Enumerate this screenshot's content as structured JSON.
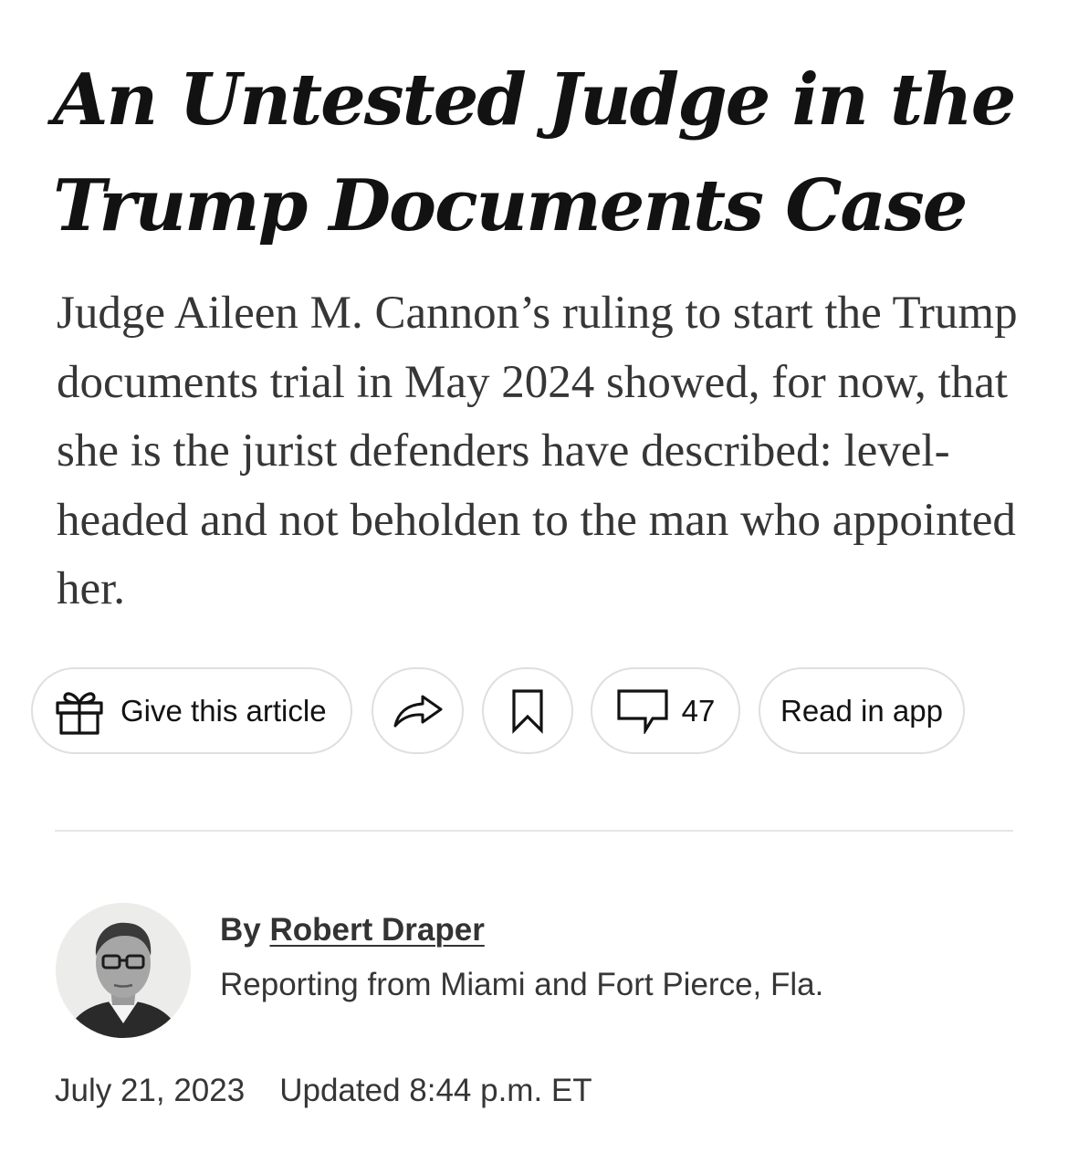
{
  "article": {
    "headline": "An Untested Judge in the Trump Documents Case",
    "summary": "Judge Aileen M. Cannon’s ruling to start the Trump documents trial in May 2024 showed, for now, that she is the jurist defenders have described: level-headed and not beholden to the man who appointed her."
  },
  "actions": {
    "gift": {
      "label": "Give this article",
      "icon": "gift-icon"
    },
    "share": {
      "icon": "share-arrow-icon"
    },
    "save": {
      "icon": "bookmark-icon"
    },
    "comments": {
      "count": "47",
      "icon": "comment-bubble-icon"
    },
    "app": {
      "label": "Read in app"
    }
  },
  "byline": {
    "prefix": "By",
    "author": "Robert Draper",
    "reporting": "Reporting from Miami and Fort Pierce, Fla."
  },
  "meta": {
    "published": "July 21, 2023",
    "updated": "Updated 8:44 p.m. ET"
  }
}
